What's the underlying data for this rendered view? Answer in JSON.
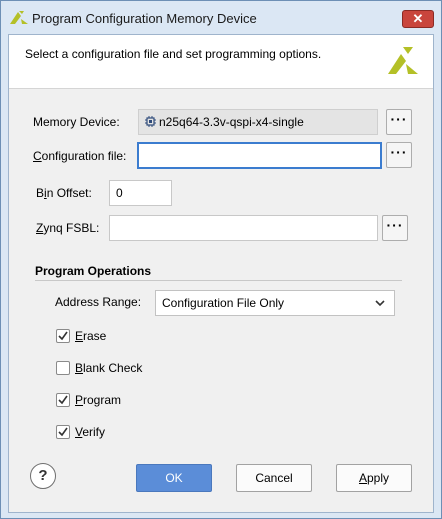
{
  "window": {
    "title": "Program Configuration Memory Device",
    "close_label": "✕"
  },
  "header": {
    "description": "Select a configuration file and set programming options."
  },
  "form": {
    "memory_device": {
      "label": "Memory Device:",
      "value": "n25q64-3.3v-qspi-x4-single",
      "browse_label": "···"
    },
    "configuration_file": {
      "label_mnemonic": "C",
      "label_rest": "onfiguration file:",
      "value": "",
      "browse_label": "···"
    },
    "bin_offset": {
      "label_pre": "B",
      "label_mnemonic": "i",
      "label_rest": "n Offset:",
      "value": "0"
    },
    "zynq_fsbl": {
      "label_mnemonic": "Z",
      "label_rest": "ynq FSBL:",
      "value": "",
      "browse_label": "···"
    }
  },
  "program_operations": {
    "title": "Program Operations",
    "address_range": {
      "label": "Address Range:",
      "selected": "Configuration File Only"
    },
    "options": [
      {
        "mnemonic": "E",
        "rest": "rase",
        "checked": true
      },
      {
        "mnemonic": "B",
        "rest": "lank Check",
        "checked": false
      },
      {
        "mnemonic": "P",
        "rest": "rogram",
        "checked": true
      },
      {
        "mnemonic": "V",
        "rest": "erify",
        "checked": true
      }
    ]
  },
  "footer": {
    "help_label": "?",
    "ok_label": "OK",
    "cancel_label": "Cancel",
    "apply_mnemonic": "A",
    "apply_rest": "pply"
  },
  "colors": {
    "accent": "#5b8dd8",
    "focus_border": "#3b7ccf",
    "logo": "#b4c027"
  },
  "icons": {
    "title": "xilinx-logo-icon",
    "memory_chip": "chip-icon",
    "dropdown": "chevron-down-icon",
    "checkbox_mark": "checkmark-icon"
  }
}
